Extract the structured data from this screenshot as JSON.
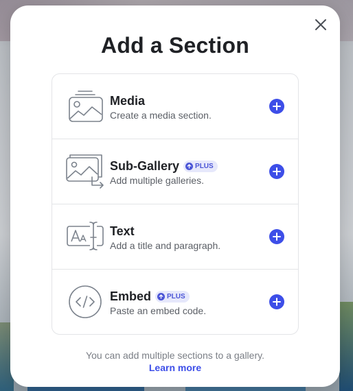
{
  "modal": {
    "title": "Add a Section",
    "close_label": "close"
  },
  "sections": [
    {
      "title": "Media",
      "description": "Create a media section.",
      "badge": "",
      "icon": "media-icon"
    },
    {
      "title": "Sub-Gallery",
      "description": "Add multiple galleries.",
      "badge": "PLUS",
      "icon": "sub-gallery-icon"
    },
    {
      "title": "Text",
      "description": "Add a title and paragraph.",
      "badge": "",
      "icon": "text-icon"
    },
    {
      "title": "Embed",
      "description": "Paste an embed code.",
      "badge": "PLUS",
      "icon": "embed-icon"
    }
  ],
  "footer": {
    "note": "You can add multiple sections to a gallery.",
    "link": "Learn more"
  },
  "colors": {
    "accent": "#3d4ee8",
    "badge_bg": "#e6e8fb",
    "icon_stroke": "#7b828c"
  }
}
